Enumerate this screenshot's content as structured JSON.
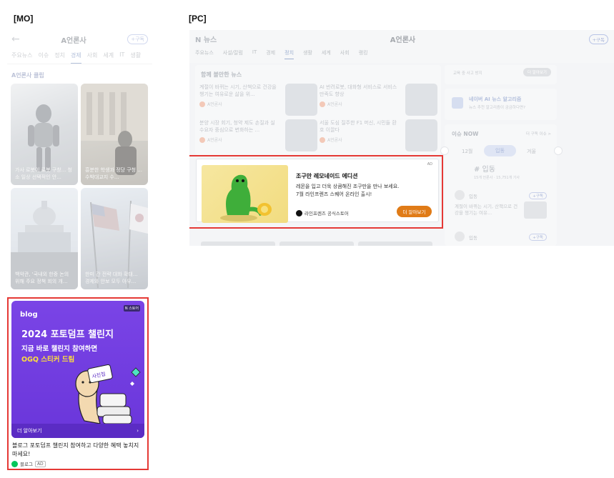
{
  "labels": {
    "mo": "[MO]",
    "pc": "[PC]"
  },
  "mo": {
    "back_icon": "arrow-left-icon",
    "title": "A언론사",
    "subscribe": "+구독",
    "tabs": [
      "주요뉴스",
      "이슈",
      "정치",
      "경제",
      "사회",
      "세계",
      "IT",
      "생활"
    ],
    "active_tab": "경제",
    "section_title": "A언론사 클립",
    "clips": [
      {
        "caption": "가사 로봇이 로봇 구창... 청소 일상 선택적인 안..."
      },
      {
        "caption": "흥분한 학생과 정당 구청 ... 수박대교지 수..."
      },
      {
        "caption": "백악관, '국내외 한중 논의 위해 주요 정책 회의 개..."
      },
      {
        "caption": "한미 간 전략 대화 확대... 경제와 안보 모두 아우..."
      }
    ],
    "ad": {
      "brand": "blog",
      "badge": "N 스토어",
      "headline": "2024 포토덤프 챌린지",
      "sub1": "지금 바로 챌린지 참여하면",
      "sub2": "OGQ 스티커 드림",
      "sticker_text": "사진첩",
      "more": "더 알아보기",
      "description": "블로그 포토덤프 챌린지 참여하고 다양한 혜택 놓치지 마세요!",
      "advertiser": "블로그",
      "ad_label": "AD",
      "accent": "#6a36da",
      "highlight": "#ffe03a"
    }
  },
  "pc": {
    "logo": "N 뉴스",
    "title": "A언론사",
    "subscribe": "+구독",
    "tabs": [
      "주요뉴스",
      "사설/칼럼",
      "IT",
      "경제",
      "정치",
      "생활",
      "세계",
      "사회",
      "랭킹"
    ],
    "active_tab": "정치",
    "section_title": "함께 볼만한 뉴스",
    "news": [
      {
        "title": "계절이 바뀌는 시기, 산책으로 건강을 챙기는 여유로운 삶을 위...",
        "source": "A언론사"
      },
      {
        "title": "AI 반려로봇, 대화형 서비스로 서비스 만족도 향상",
        "source": "A언론사"
      },
      {
        "title": "분양 시장 회기, 청약 제도 손질과 실수요자 중심으로 변화하는 ...",
        "source": "A언론사"
      },
      {
        "title": "서울 도심 질주한 F1 머신, 시민들 환호 이끌다",
        "source": "A언론사"
      }
    ],
    "right": {
      "top_caption": "교육 중 사고 방지",
      "top_button": "더 알아보기",
      "algo_title": "네이버 AI 뉴스 알고리즘",
      "algo_sub": "뉴스 추천 알고리즘이 궁금하다면?",
      "issue_title": "이슈 NOW",
      "issue_link": "더 구독 이슈 >",
      "months": [
        "12월",
        "입동",
        "겨울"
      ],
      "active_month": "입동",
      "hashtag": "# 입동",
      "hash_meta": "15개 언론사 · 15,751개 기사",
      "item_name": "입동",
      "item_sub": "+구독",
      "item_text": "계절이 바뀌는 시기, 산책으로 건강을 챙기는 여유..."
    },
    "ad": {
      "label": "AD",
      "headline": "조구만 레모네이드 에디션",
      "desc1": "레몬을 입고 더욱 상큼해진 조구만을 만나 보세요.",
      "desc2": "7월 라인프렌즈 스퀘어 온라인 출시!",
      "source": "라인프렌즈 공식스토어",
      "button": "더 알아보기",
      "button_color": "#e07b17"
    }
  },
  "colors": {
    "highlight_border": "#e53935"
  }
}
